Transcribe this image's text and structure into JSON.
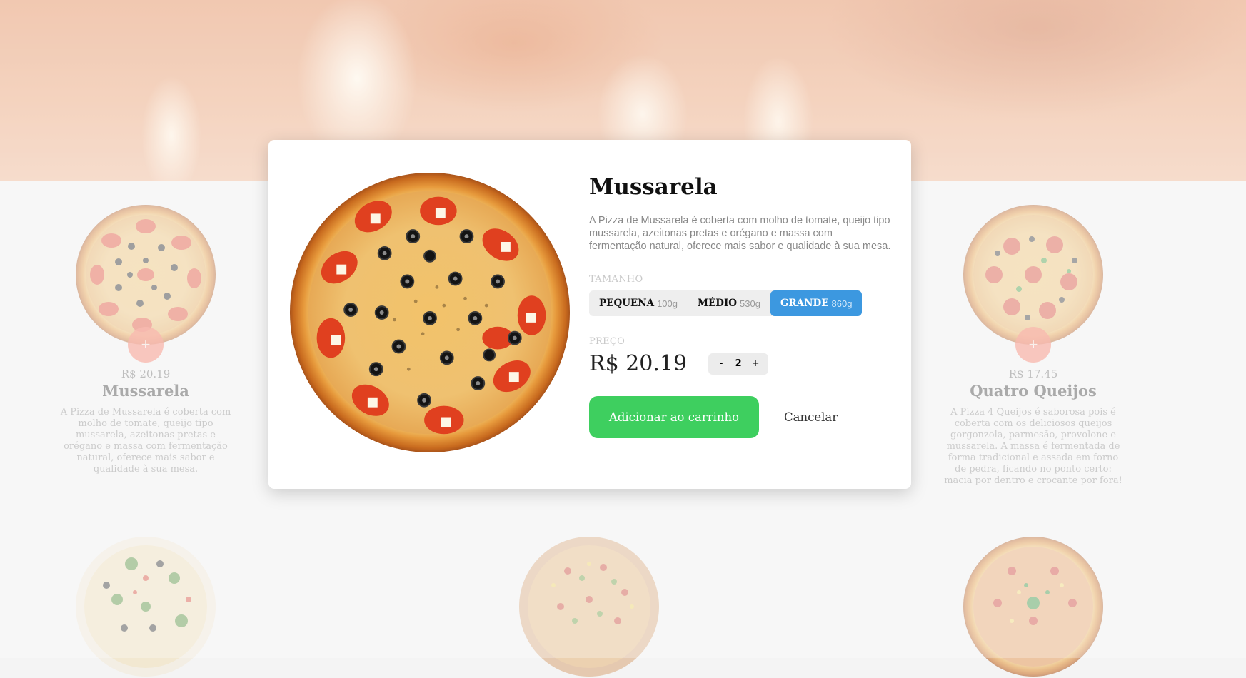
{
  "hero": {
    "image": "wood-fired-oven-flames"
  },
  "products": [
    {
      "price": "R$ 20.19",
      "name": "Mussarela",
      "description": "A Pizza de Mussarela é coberta com molho de tomate, queijo tipo mussarela, azeitonas pretas e orégano e massa com fermentação natural, oferece mais sabor e qualidade à sua mesa.",
      "add_label": "+"
    },
    {
      "price": "R$ 17.45",
      "name": "Quatro Queijos",
      "description": "A Pizza 4 Queijos é saborosa pois é coberta com os deliciosos queijos gorgonzola, parmesão, provolone e mussarela. A massa é fermentada de forma tradicional e assada em forno de pedra, ficando no ponto certo: macia por dentro e crocante por fora!",
      "add_label": "+"
    }
  ],
  "modal": {
    "title": "Mussarela",
    "description": "A Pizza de Mussarela é coberta com molho de tomate, queijo tipo mussarela, azeitonas pretas e orégano e massa com fermentação natural, oferece mais sabor e qualidade à sua mesa.",
    "size_label": "TAMANHO",
    "sizes": [
      {
        "name": "PEQUENA",
        "weight": "100g",
        "active": false
      },
      {
        "name": "MÉDIO",
        "weight": "530g",
        "active": false
      },
      {
        "name": "GRANDE",
        "weight": "860g",
        "active": true
      }
    ],
    "price_label": "PREÇO",
    "price": "R$ 20.19",
    "quantity": {
      "minus": "-",
      "value": "2",
      "plus": "+"
    },
    "add_to_cart": "Adicionar ao carrinho",
    "cancel": "Cancelar"
  },
  "colors": {
    "accent_blue": "#3c98e0",
    "cart_green": "#3ecf5f",
    "add_button": "#f6a092"
  }
}
